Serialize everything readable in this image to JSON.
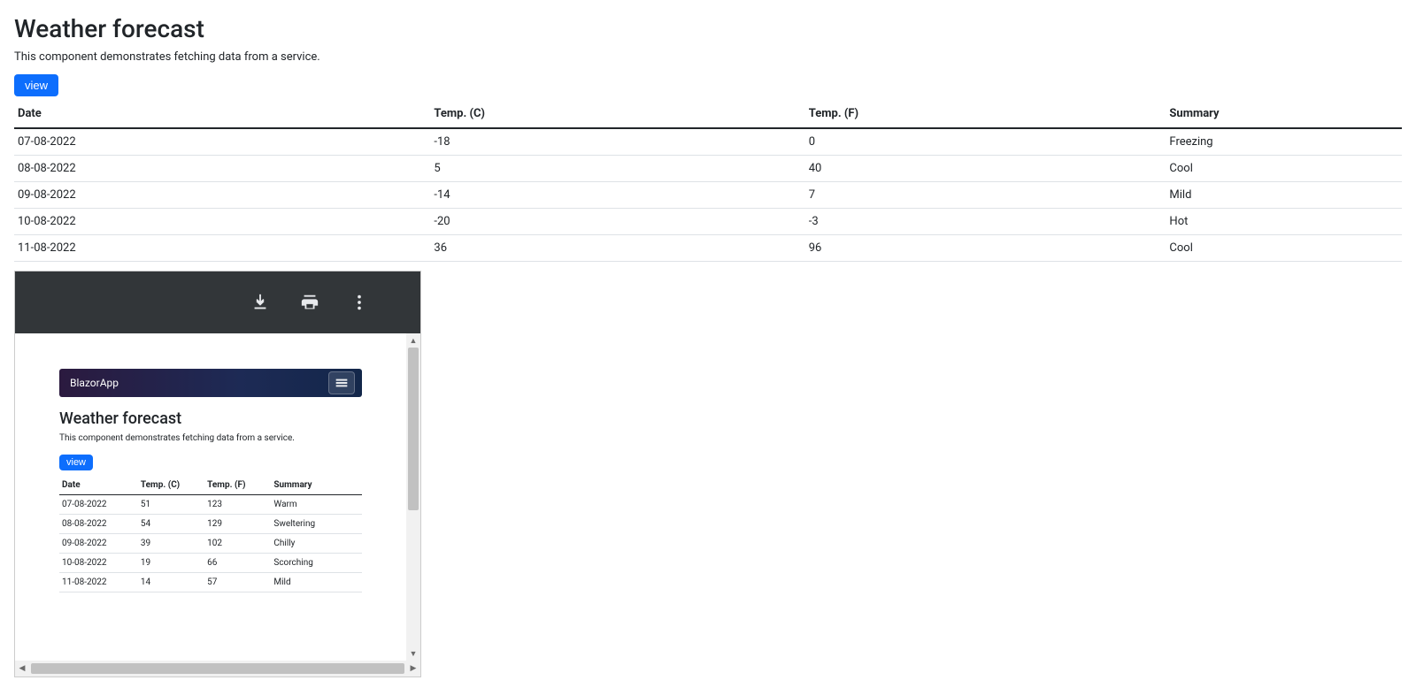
{
  "page": {
    "title": "Weather forecast",
    "subtitle": "This component demonstrates fetching data from a service.",
    "view_button": "view"
  },
  "table": {
    "headers": {
      "date": "Date",
      "tc": "Temp. (C)",
      "tf": "Temp. (F)",
      "summary": "Summary"
    },
    "rows": [
      {
        "date": "07-08-2022",
        "tc": "-18",
        "tf": "0",
        "summary": "Freezing"
      },
      {
        "date": "08-08-2022",
        "tc": "5",
        "tf": "40",
        "summary": "Cool"
      },
      {
        "date": "09-08-2022",
        "tc": "-14",
        "tf": "7",
        "summary": "Mild"
      },
      {
        "date": "10-08-2022",
        "tc": "-20",
        "tf": "-3",
        "summary": "Hot"
      },
      {
        "date": "11-08-2022",
        "tc": "36",
        "tf": "96",
        "summary": "Cool"
      }
    ]
  },
  "pdf": {
    "app_name": "BlazorApp",
    "title": "Weather forecast",
    "subtitle": "This component demonstrates fetching data from a service.",
    "view_button": "view",
    "headers": {
      "date": "Date",
      "tc": "Temp. (C)",
      "tf": "Temp. (F)",
      "summary": "Summary"
    },
    "rows": [
      {
        "date": "07-08-2022",
        "tc": "51",
        "tf": "123",
        "summary": "Warm"
      },
      {
        "date": "08-08-2022",
        "tc": "54",
        "tf": "129",
        "summary": "Sweltering"
      },
      {
        "date": "09-08-2022",
        "tc": "39",
        "tf": "102",
        "summary": "Chilly"
      },
      {
        "date": "10-08-2022",
        "tc": "19",
        "tf": "66",
        "summary": "Scorching"
      },
      {
        "date": "11-08-2022",
        "tc": "14",
        "tf": "57",
        "summary": "Mild"
      }
    ]
  },
  "icons": {
    "download": "download-icon",
    "print": "print-icon",
    "more": "more-icon",
    "hamburger": "hamburger-icon"
  }
}
